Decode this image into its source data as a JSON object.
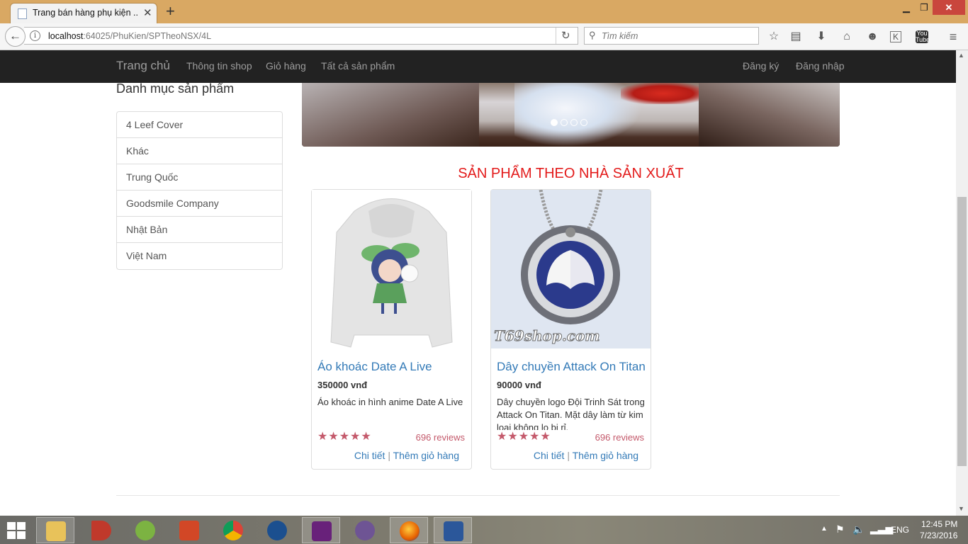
{
  "browser": {
    "tab_title": "Trang bán hàng phụ kiện ...",
    "url_host": "localhost",
    "url_path": ":64025/PhuKien/SPTheoNSX/4L",
    "search_placeholder": "Tìm kiếm"
  },
  "nav": {
    "brand": "Trang chủ",
    "links": [
      "Thông tin shop",
      "Giỏ hàng",
      "Tất cả sản phẩm"
    ],
    "right_links": [
      "Đăng ký",
      "Đăng nhập"
    ]
  },
  "sidebar": {
    "title": "Danh mục sản phẩm",
    "categories": [
      "4 Leef Cover",
      "Khác",
      "Trung Quốc",
      "Goodsmile Company",
      "Nhật Bản",
      "Việt Nam"
    ]
  },
  "carousel": {
    "slide_count": 4,
    "active_index": 0
  },
  "section_title": "SẢN PHẨM THEO NHÀ SẢN XUẤT",
  "products": [
    {
      "name": "Áo khoác Date A Live",
      "price": "350000 vnđ",
      "description": "Áo khoác in hình anime Date A Live",
      "stars": "★★★★★",
      "rating": 5,
      "reviews": "696 reviews",
      "detail_label": "Chi tiết",
      "separator": "|",
      "add_cart_label": "Thêm giỏ hàng"
    },
    {
      "name": "Dây chuyền Attack On Titan",
      "price": "90000 vnđ",
      "description": "Dây chuyền logo Đội Trinh Sát trong Attack On Titan. Mặt dây làm từ kim loại không lo bị rỉ.",
      "watermark": "T69shop.com",
      "stars": "★★★★★",
      "rating": 5,
      "reviews": "696 reviews",
      "detail_label": "Chi tiết",
      "separator": "|",
      "add_cart_label": "Thêm giỏ hàng"
    }
  ],
  "taskbar": {
    "language": "ENG",
    "time": "12:45 PM",
    "date": "7/23/2016"
  },
  "colors": {
    "navbar_bg": "#222222",
    "link_blue": "#337ab7",
    "section_red": "#e31b1b",
    "rating_pink": "#c4596b",
    "titlebar": "#d9a863"
  }
}
